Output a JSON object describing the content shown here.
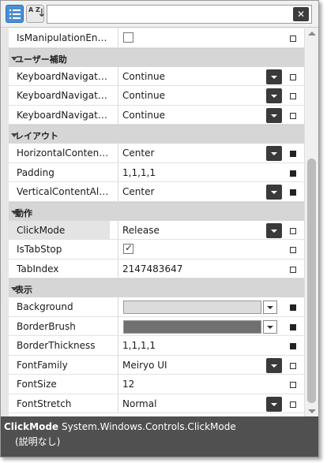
{
  "toolbar": {
    "search": {
      "value": "",
      "placeholder": ""
    },
    "clear_label": "✕",
    "sort_az_label": "A Z"
  },
  "grid": {
    "top_row": {
      "name": "IsManipulationEn…",
      "type": "checkbox",
      "checked": false,
      "mark": "empty"
    },
    "categories": [
      {
        "name": "ユーザー補助",
        "rows": [
          {
            "name": "KeyboardNavigati…",
            "value": "Continue",
            "type": "dropdown",
            "mark": "empty"
          },
          {
            "name": "KeyboardNavigati…",
            "value": "Continue",
            "type": "dropdown",
            "mark": "empty"
          },
          {
            "name": "KeyboardNavigati…",
            "value": "Continue",
            "type": "dropdown",
            "mark": "empty"
          }
        ]
      },
      {
        "name": "レイアウト",
        "rows": [
          {
            "name": "HorizontalContent…",
            "value": "Center",
            "type": "dropdown",
            "mark": "filled"
          },
          {
            "name": "Padding",
            "value": "1,1,1,1",
            "type": "text",
            "mark": "filled"
          },
          {
            "name": "VerticalContentAli…",
            "value": "Center",
            "type": "dropdown",
            "mark": "filled"
          }
        ]
      },
      {
        "name": "動作",
        "rows": [
          {
            "name": "ClickMode",
            "value": "Release",
            "type": "dropdown",
            "mark": "empty",
            "selected": true
          },
          {
            "name": "IsTabStop",
            "type": "checkbox",
            "checked": true,
            "mark": "empty"
          },
          {
            "name": "TabIndex",
            "value": "2147483647",
            "type": "text",
            "mark": "empty"
          }
        ]
      },
      {
        "name": "表示",
        "rows": [
          {
            "name": "Background",
            "type": "brush",
            "color": "#dcdcdc",
            "mark": "filled"
          },
          {
            "name": "BorderBrush",
            "type": "brush",
            "color": "#707070",
            "mark": "filled"
          },
          {
            "name": "BorderThickness",
            "value": "1,1,1,1",
            "type": "text",
            "mark": "filled"
          },
          {
            "name": "FontFamily",
            "value": "Meiryo UI",
            "type": "dropdown",
            "mark": "empty"
          },
          {
            "name": "FontSize",
            "value": "12",
            "type": "text",
            "mark": "empty"
          },
          {
            "name": "FontStretch",
            "value": "Normal",
            "type": "dropdown",
            "mark": "empty"
          }
        ]
      }
    ]
  },
  "description": {
    "name": "ClickMode",
    "type": "System.Windows.Controls.ClickMode",
    "note": "(説明なし)"
  },
  "colors": {
    "accent": "#4a8fd6",
    "desc_bg": "#505050",
    "category_bg": "#d6d6d6"
  }
}
